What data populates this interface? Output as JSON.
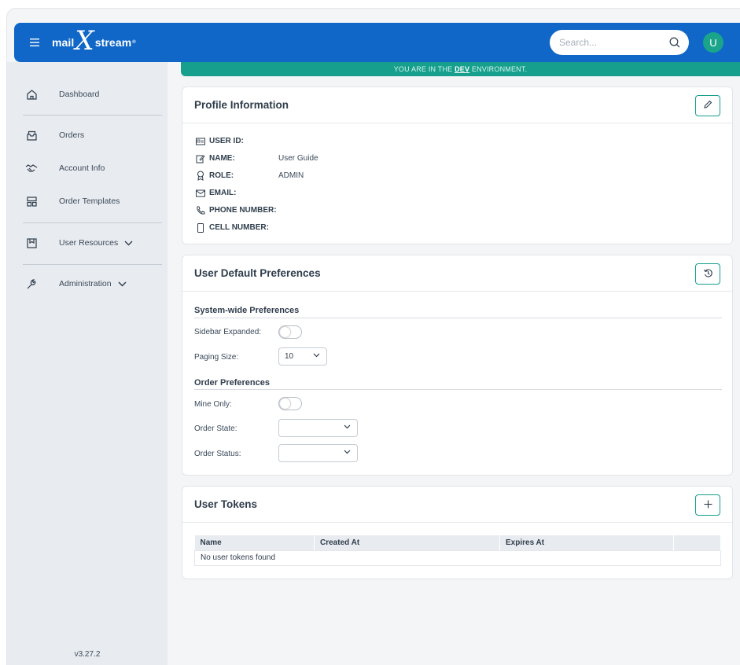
{
  "header": {
    "logo_text_left": "mail",
    "logo_x": "X",
    "logo_text_right": "stream",
    "logo_mark": "®",
    "menu_icon": "hamburger-icon",
    "search_placeholder": "Search...",
    "search_icon": "search-icon",
    "avatar_initial": "U"
  },
  "environment_banner": {
    "prefix": "YOU ARE IN THE ",
    "env": "DEV",
    "suffix": " ENVIRONMENT."
  },
  "sidebar": {
    "items": [
      {
        "label": "Dashboard",
        "icon": "home-icon"
      },
      {
        "label": "Orders",
        "icon": "orders-tray-icon"
      },
      {
        "label": "Account Info",
        "icon": "handshake-icon"
      },
      {
        "label": "Order Templates",
        "icon": "templates-icon"
      },
      {
        "label": "User Resources",
        "icon": "bookmark-box-icon"
      },
      {
        "label": "Administration",
        "icon": "wrench-icon"
      }
    ],
    "version": "v3.27.2"
  },
  "profile": {
    "title": "Profile Information",
    "edit_icon": "pencil-icon",
    "fields": [
      {
        "label": "USER ID:",
        "value": "",
        "icon": "id-card-icon"
      },
      {
        "label": "NAME:",
        "value": "User Guide",
        "icon": "edit-note-icon"
      },
      {
        "label": "ROLE:",
        "value": "ADMIN",
        "icon": "award-icon"
      },
      {
        "label": "EMAIL:",
        "value": "",
        "icon": "envelope-icon"
      },
      {
        "label": "PHONE NUMBER:",
        "value": "",
        "icon": "phone-icon"
      },
      {
        "label": "CELL NUMBER:",
        "value": "",
        "icon": "mobile-icon"
      }
    ]
  },
  "preferences": {
    "title": "User Default Preferences",
    "reset_icon": "history-icon",
    "system_title": "System-wide Preferences",
    "sidebar_expanded_label": "Sidebar Expanded:",
    "sidebar_expanded": false,
    "paging_size_label": "Paging Size:",
    "paging_size": "10",
    "order_title": "Order Preferences",
    "mine_only_label": "Mine Only:",
    "mine_only": false,
    "order_state_label": "Order State:",
    "order_state": "",
    "order_status_label": "Order Status:",
    "order_status": ""
  },
  "tokens": {
    "title": "User Tokens",
    "add_icon": "plus-icon",
    "columns": [
      "Name",
      "Created At",
      "Expires At",
      ""
    ],
    "empty_text": "No user tokens found"
  },
  "colors": {
    "header_blue": "#1067c7",
    "accent_teal": "#159f8c",
    "avatar_green": "#1aa58a"
  }
}
